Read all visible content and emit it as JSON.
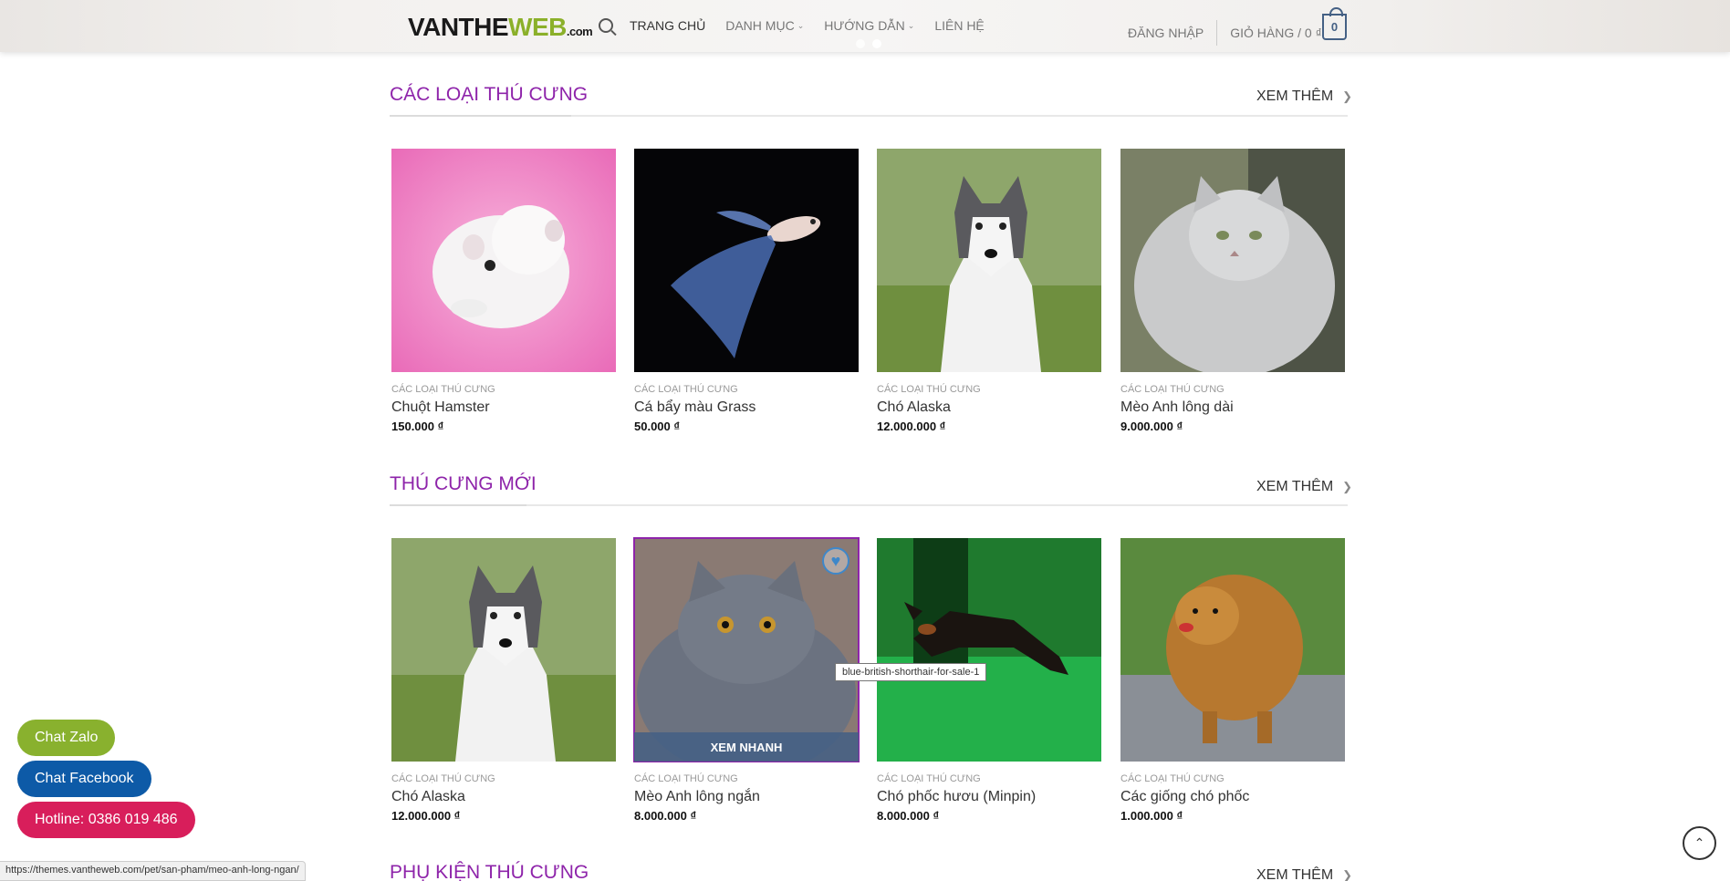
{
  "header": {
    "logo_main": "VANTHE",
    "logo_w": "WEB",
    "logo_com": ".com",
    "nav": [
      {
        "label": "TRANG CHỦ",
        "active": true,
        "dropdown": false
      },
      {
        "label": "DANH MỤC",
        "active": false,
        "dropdown": true
      },
      {
        "label": "HƯỚNG DẪN",
        "active": false,
        "dropdown": true
      },
      {
        "label": "LIÊN HỆ",
        "active": false,
        "dropdown": false
      }
    ],
    "login": "ĐĂNG NHẬP",
    "cart_label": "GIỎ HÀNG / 0 ₫",
    "cart_count": "0"
  },
  "sections": [
    {
      "title": "CÁC LOẠI THÚ CƯNG",
      "see_more": "XEM THÊM",
      "products": [
        {
          "category": "CÁC LOẠI THÚ CƯNG",
          "name": "Chuột Hamster",
          "price": "150.000 ₫"
        },
        {
          "category": "CÁC LOẠI THÚ CƯNG",
          "name": "Cá bẩy màu Grass",
          "price": "50.000 ₫"
        },
        {
          "category": "CÁC LOẠI THÚ CƯNG",
          "name": "Chó Alaska",
          "price": "12.000.000 ₫"
        },
        {
          "category": "CÁC LOẠI THÚ CƯNG",
          "name": "Mèo Anh lông dài",
          "price": "9.000.000 ₫"
        }
      ]
    },
    {
      "title": "THÚ CƯNG MỚI",
      "see_more": "XEM THÊM",
      "products": [
        {
          "category": "CÁC LOẠI THÚ CƯNG",
          "name": "Chó Alaska",
          "price": "12.000.000 ₫"
        },
        {
          "category": "CÁC LOẠI THÚ CƯNG",
          "name": "Mèo Anh lông ngắn",
          "price": "8.000.000 ₫"
        },
        {
          "category": "CÁC LOẠI THÚ CƯNG",
          "name": "Chó phốc hươu (Minpin)",
          "price": "8.000.000 ₫"
        },
        {
          "category": "CÁC LOẠI THÚ CƯNG",
          "name": "Các giống chó phốc",
          "price": "1.000.000 ₫"
        }
      ]
    },
    {
      "title": "PHỤ KIỆN THÚ CƯNG",
      "see_more": "XEM THÊM"
    }
  ],
  "quick_view": "XEM NHANH",
  "tooltip": "blue-british-shorthair-for-sale-1",
  "float": {
    "zalo": "Chat Zalo",
    "facebook": "Chat Facebook",
    "hotline": "Hotline: 0386 019 486"
  },
  "status_url": "https://themes.vantheweb.com/pet/san-pham/meo-anh-long-ngan/",
  "colors": {
    "accent": "#8e24aa",
    "primary": "#446084",
    "zalo": "#89b12e",
    "facebook": "#0d5aa7",
    "hotline": "#d81e5b"
  }
}
